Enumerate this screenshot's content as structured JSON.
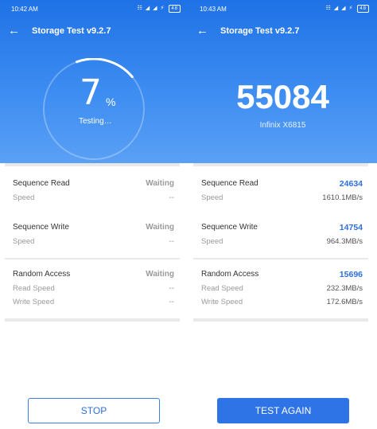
{
  "left": {
    "status_time": "10:42 AM",
    "status_icons": "☷ ◢ ◢ ⚡",
    "battery": "48",
    "title": "Storage Test v9.2.7",
    "back_glyph": "←",
    "progress_percent": 7,
    "progress_number": "7",
    "progress_sign": "%",
    "progress_text": "Testing…",
    "sections": {
      "seq_read": {
        "label": "Sequence Read",
        "status": "Waiting",
        "sub_label": "Speed",
        "sub_value": "--"
      },
      "seq_write": {
        "label": "Sequence Write",
        "status": "Waiting",
        "sub_label": "Speed",
        "sub_value": "--"
      },
      "random": {
        "label": "Random Access",
        "status": "Waiting",
        "read_label": "Read Speed",
        "read_value": "--",
        "write_label": "Write Speed",
        "write_value": "--"
      }
    },
    "button_label": "STOP"
  },
  "right": {
    "status_time": "10:43 AM",
    "status_icons": "☷ ◢ ◢ ⚡",
    "battery": "48",
    "title": "Storage Test v9.2.7",
    "back_glyph": "←",
    "score": "55084",
    "device": "Infinix X6815",
    "sections": {
      "seq_read": {
        "label": "Sequence Read",
        "score": "24634",
        "sub_label": "Speed",
        "sub_value": "1610.1MB/s"
      },
      "seq_write": {
        "label": "Sequence Write",
        "score": "14754",
        "sub_label": "Speed",
        "sub_value": "964.3MB/s"
      },
      "random": {
        "label": "Random Access",
        "score": "15696",
        "read_label": "Read Speed",
        "read_value": "232.3MB/s",
        "write_label": "Write Speed",
        "write_value": "172.6MB/s"
      }
    },
    "button_label": "TEST AGAIN"
  },
  "colors": {
    "accent": "#2f74e6",
    "header_top": "#1f72e6",
    "header_bottom": "#5aa0f5",
    "score_blue": "#2e6fde"
  },
  "icons": {
    "back": "back-arrow-icon",
    "wifi": "wifi-icon",
    "signal": "signal-icon",
    "battery": "battery-icon"
  }
}
